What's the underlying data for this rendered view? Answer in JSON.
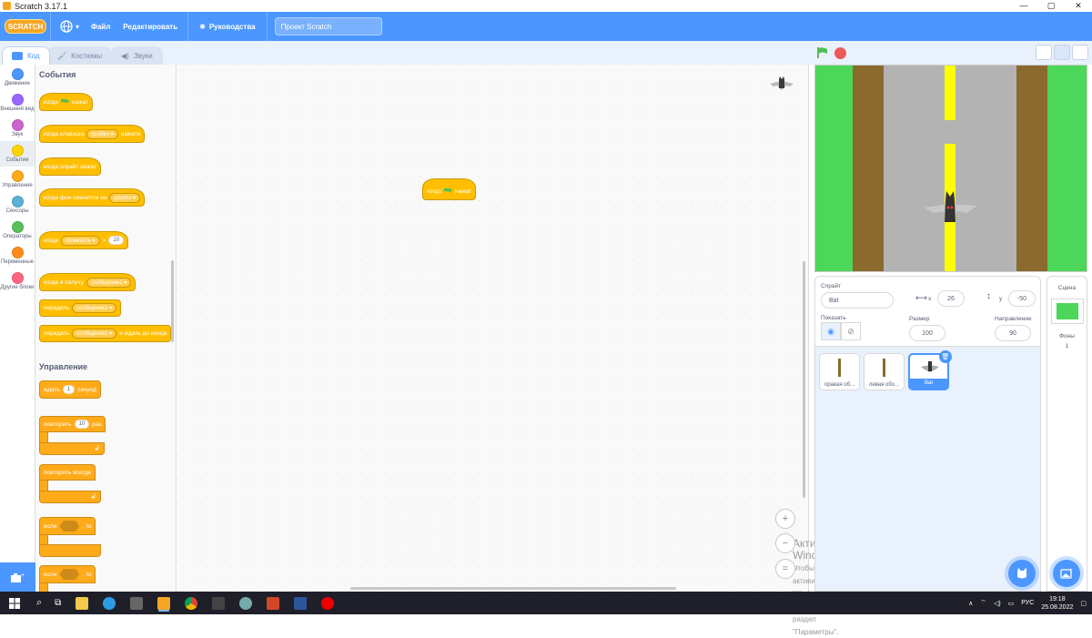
{
  "window": {
    "title": "Scratch 3.17.1",
    "min": "—",
    "max": "▢",
    "close": "✕"
  },
  "menubar": {
    "logo": "SCRATCH",
    "file": "Файл",
    "edit": "Редактировать",
    "tutorials": "Руководства",
    "project_title": "Проект Scratch"
  },
  "tabs": {
    "code": "Код",
    "costumes": "Костюмы",
    "sounds": "Звуки"
  },
  "categories": [
    {
      "label": "Движение",
      "color": "#4c97ff"
    },
    {
      "label": "Внешний вид",
      "color": "#9966ff"
    },
    {
      "label": "Звук",
      "color": "#cf63cf"
    },
    {
      "label": "События",
      "color": "#ffd500"
    },
    {
      "label": "Управление",
      "color": "#ffab19"
    },
    {
      "label": "Сенсоры",
      "color": "#5cb1d6"
    },
    {
      "label": "Операторы",
      "color": "#59c059"
    },
    {
      "label": "Переменные",
      "color": "#ff8c1a"
    },
    {
      "label": "Другие блоки",
      "color": "#ff6680"
    }
  ],
  "palette": {
    "events_header": "События",
    "when_flag": "когда",
    "clicked": "нажат",
    "when_key": "когда клавиша",
    "key_value": "пробел",
    "pressed": "нажата",
    "when_sprite_clicked": "когда спрайт нажат",
    "when_backdrop": "когда фон сменится на",
    "backdrop_value": "дорога",
    "when_loudness": "когда",
    "loudness_value": "громкость",
    "gt": ">",
    "loudness_num": "10",
    "when_receive": "когда я получу",
    "message_value": "сообщение1",
    "broadcast": "передать",
    "broadcast_msg": "сообщение1",
    "broadcast_wait": "передать",
    "broadcast_wait_msg": "сообщение1",
    "and_wait": "и ждать до конца",
    "control_header": "Управление",
    "wait": "ждать",
    "wait_num": "1",
    "seconds": "секунд",
    "repeat": "повторить",
    "repeat_num": "10",
    "times": "раз",
    "forever": "повторять всегда",
    "if": "если",
    "then": ", то",
    "if2": "если",
    "then2": ", то"
  },
  "code_area": {
    "block_when": "когда",
    "block_clicked": "нажат",
    "zoom_in": "+",
    "zoom_out": "−",
    "zoom_reset": "="
  },
  "watermark": {
    "line1": "Активация Windows",
    "line2": "Чтобы активировать Windows, перейдите в раздел \"Параметры\"."
  },
  "sprite_info": {
    "sprite_label": "Спрайт",
    "sprite_name": "Bat",
    "x_label": "x",
    "x_value": "26",
    "y_label": "y",
    "y_value": "-50",
    "show_label": "Показать",
    "size_label": "Размер",
    "size_value": "100",
    "direction_label": "Направление",
    "direction_value": "90"
  },
  "sprites": [
    {
      "name": "правая об..."
    },
    {
      "name": "левая обо..."
    },
    {
      "name": "Bat"
    }
  ],
  "scene": {
    "label": "Сцена",
    "backdrops_label": "Фоны",
    "backdrops_count": "1"
  },
  "taskbar": {
    "lang": "РУС",
    "time": "19:18",
    "date": "25.08.2022"
  },
  "colors": {
    "events": "#ffbf00",
    "control": "#ffab19",
    "accent": "#4c97ff",
    "road": "#b3b3b3",
    "dirt": "#8a6a2d",
    "grass": "#4cd65a",
    "line": "#ffff00"
  }
}
